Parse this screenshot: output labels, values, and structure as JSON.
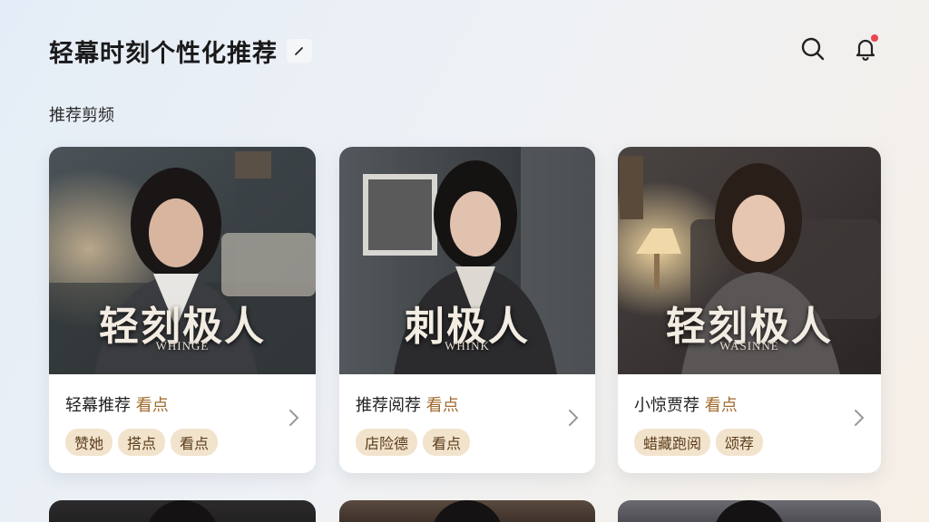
{
  "header": {
    "title": "轻幕时刻个性化推荐"
  },
  "section": {
    "title": "推荐剪频"
  },
  "cards": [
    {
      "poster_title": "轻刻极人",
      "poster_sub": "WHINGE",
      "title": "轻幕推荐",
      "highlight": "看点",
      "tags": [
        "赞她",
        "搭点",
        "看点"
      ]
    },
    {
      "poster_title": "刺极人",
      "poster_sub": "WHINK",
      "title": "推荐阅荐",
      "highlight": "看点",
      "tags": [
        "店险德",
        "看点"
      ]
    },
    {
      "poster_title": "轻刻极人",
      "poster_sub": "WASINNE",
      "title": "小惊贾荐",
      "highlight": "看点",
      "tags": [
        "蜡藏跑阅",
        "颂荐"
      ]
    }
  ],
  "colors": {
    "accent": "#a06a2c",
    "tag_bg": "#f2e3cd",
    "badge": "#e9474e"
  },
  "icons": {
    "edit": "pencil-icon",
    "search": "search-icon",
    "notifications": "bell-icon",
    "more": "chevron-right-icon"
  }
}
